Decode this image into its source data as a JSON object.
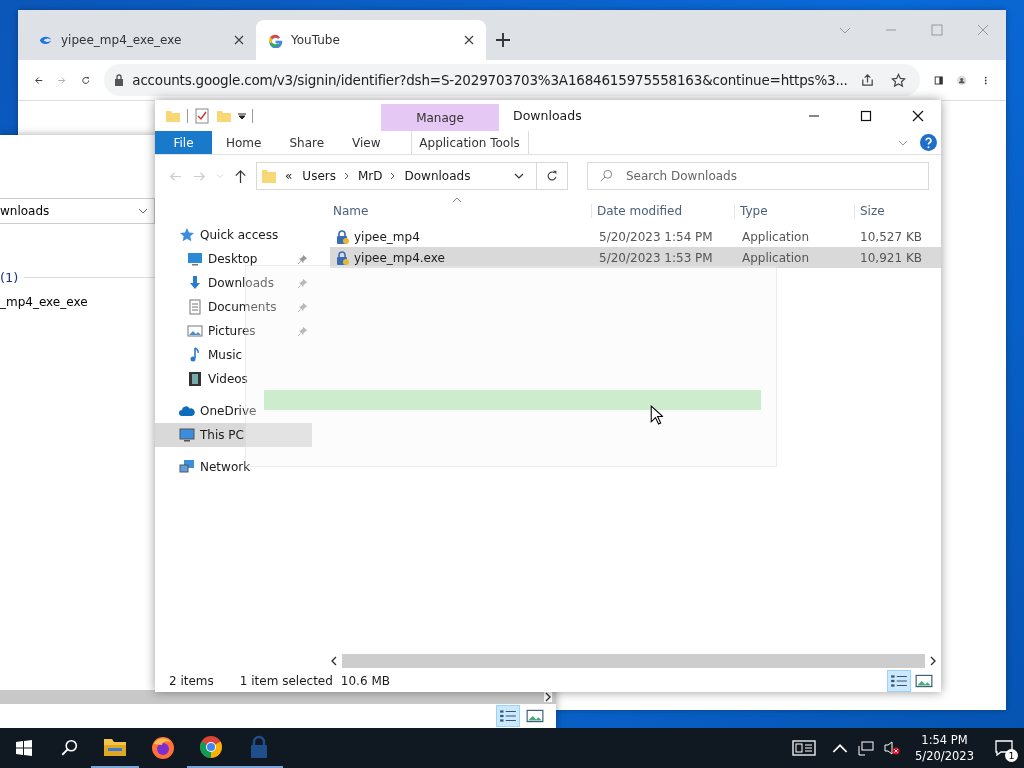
{
  "browser": {
    "tabs": [
      {
        "title": "yipee_mp4_exe_exe",
        "selected": false
      },
      {
        "title": "YouTube",
        "selected": true
      }
    ],
    "address": "accounts.google.com/v3/signin/identifier?dsh=S-2029703703%3A1684615975558163&continue=https%3..."
  },
  "background_window": {
    "field_value": "wnloads",
    "group": "(1)",
    "item": "_mp4_exe_exe"
  },
  "explorer": {
    "title": "Downloads",
    "context_tab": "Manage",
    "ribbon_tabs": [
      {
        "label": "File",
        "kind": "file",
        "selected": false
      },
      {
        "label": "Home",
        "kind": "tab",
        "selected": false
      },
      {
        "label": "Share",
        "kind": "tab",
        "selected": false
      },
      {
        "label": "View",
        "kind": "tab",
        "selected": false
      },
      {
        "label": "Application Tools",
        "kind": "context",
        "selected": false
      }
    ],
    "breadcrumb": [
      "«",
      "Users",
      "MrD",
      "Downloads"
    ],
    "search": {
      "placeholder": "Search Downloads"
    },
    "nav": [
      {
        "label": "Quick access",
        "selected": false,
        "children": [
          {
            "label": "Desktop",
            "pinned": true,
            "selected": false
          },
          {
            "label": "Downloads",
            "pinned": true,
            "selected": false
          },
          {
            "label": "Documents",
            "pinned": true,
            "selected": false
          },
          {
            "label": "Pictures",
            "pinned": true,
            "selected": false
          },
          {
            "label": "Music",
            "pinned": false,
            "selected": false
          },
          {
            "label": "Videos",
            "pinned": false,
            "selected": false
          }
        ]
      },
      {
        "label": "OneDrive",
        "selected": false
      },
      {
        "label": "This PC",
        "selected": true
      },
      {
        "label": "Network",
        "selected": false
      }
    ],
    "columns": [
      "Name",
      "Date modified",
      "Type",
      "Size"
    ],
    "rows": [
      {
        "name": "yipee_mp4",
        "date": "5/20/2023 1:54 PM",
        "type": "Application",
        "size": "10,527 KB",
        "selected": false
      },
      {
        "name": "yipee_mp4.exe",
        "date": "5/20/2023 1:53 PM",
        "type": "Application",
        "size": "10,921 KB",
        "selected": true
      }
    ],
    "status": [
      "2 items",
      "1 item selected",
      "10.6 MB"
    ]
  },
  "faded_dialog": {
    "progress": {
      "level": 1
    }
  },
  "taskbar": {
    "apps": [
      {
        "running": true
      },
      {
        "running": false
      },
      {
        "running": true
      },
      {
        "running": true
      }
    ],
    "time": "1:54 PM",
    "date": "5/20/2023",
    "notifications": "1"
  }
}
